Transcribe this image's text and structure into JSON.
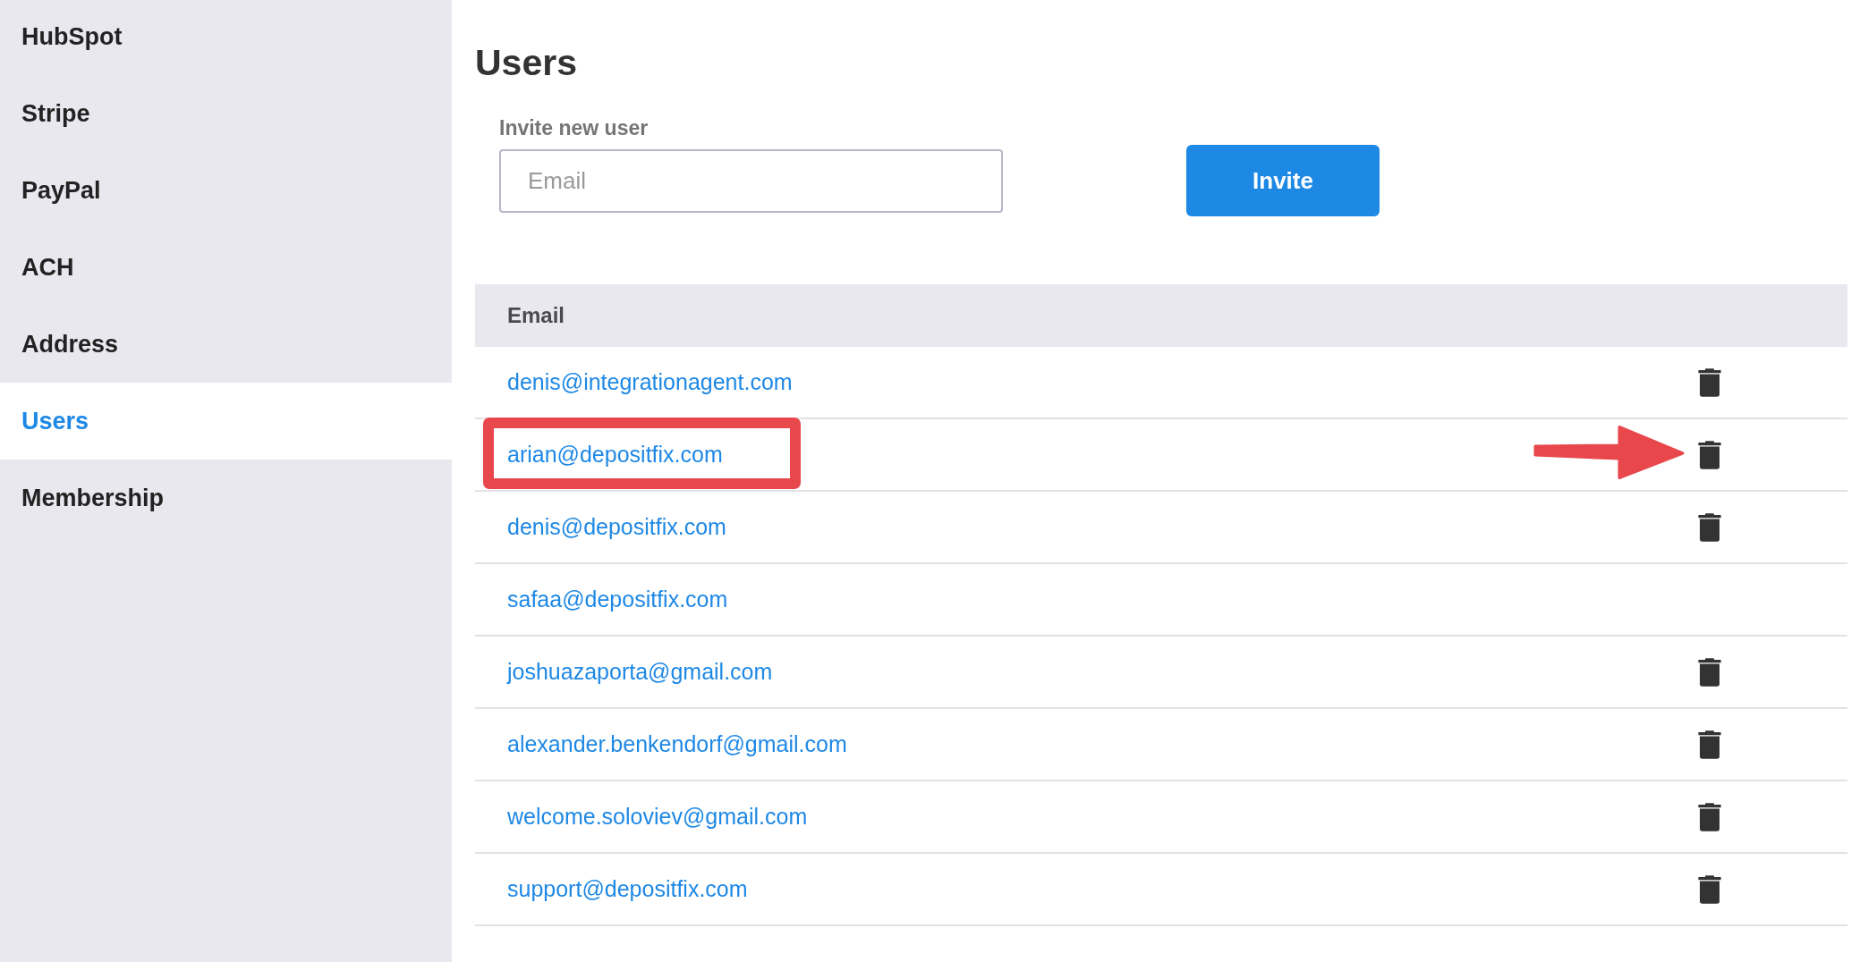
{
  "sidebar": {
    "items": [
      {
        "label": "HubSpot",
        "selected": false
      },
      {
        "label": "Stripe",
        "selected": false
      },
      {
        "label": "PayPal",
        "selected": false
      },
      {
        "label": "ACH",
        "selected": false
      },
      {
        "label": "Address",
        "selected": false
      },
      {
        "label": "Users",
        "selected": true
      },
      {
        "label": "Membership",
        "selected": false
      }
    ]
  },
  "main": {
    "title": "Users",
    "invite": {
      "label": "Invite new user",
      "placeholder": "Email",
      "button": "Invite"
    },
    "table": {
      "columns": [
        "Email"
      ],
      "rows": [
        {
          "email": "denis@integrationagent.com",
          "deletable": true,
          "highlighted": false,
          "pointed_at": false
        },
        {
          "email": "arian@depositfix.com",
          "deletable": true,
          "highlighted": true,
          "pointed_at": true
        },
        {
          "email": "denis@depositfix.com",
          "deletable": true,
          "highlighted": false,
          "pointed_at": false
        },
        {
          "email": "safaa@depositfix.com",
          "deletable": false,
          "highlighted": false,
          "pointed_at": false
        },
        {
          "email": "joshuazaporta@gmail.com",
          "deletable": true,
          "highlighted": false,
          "pointed_at": false
        },
        {
          "email": "alexander.benkendorf@gmail.com",
          "deletable": true,
          "highlighted": false,
          "pointed_at": false
        },
        {
          "email": "welcome.soloviev@gmail.com",
          "deletable": true,
          "highlighted": false,
          "pointed_at": false
        },
        {
          "email": "support@depositfix.com",
          "deletable": true,
          "highlighted": false,
          "pointed_at": false
        }
      ]
    }
  }
}
